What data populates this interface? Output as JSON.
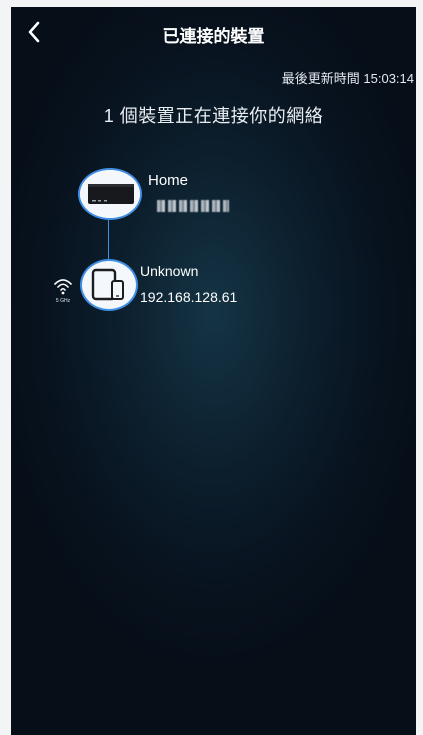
{
  "header": {
    "title": "已連接的裝置",
    "back_icon": "chevron-left-icon"
  },
  "status": {
    "last_updated": "最後更新時間 15:03:14"
  },
  "summary": "1 個裝置正在連接你的網絡",
  "router": {
    "name": "Home",
    "icon": "router-icon"
  },
  "client": {
    "name": "Unknown",
    "ip": "192.168.128.61",
    "band": "5 GHz",
    "icon": "tablet-phone-icon",
    "signal_icon": "wifi-icon"
  },
  "colors": {
    "accent": "#3f8fe6",
    "background": "#0c1e2c",
    "text": "#ffffff"
  }
}
